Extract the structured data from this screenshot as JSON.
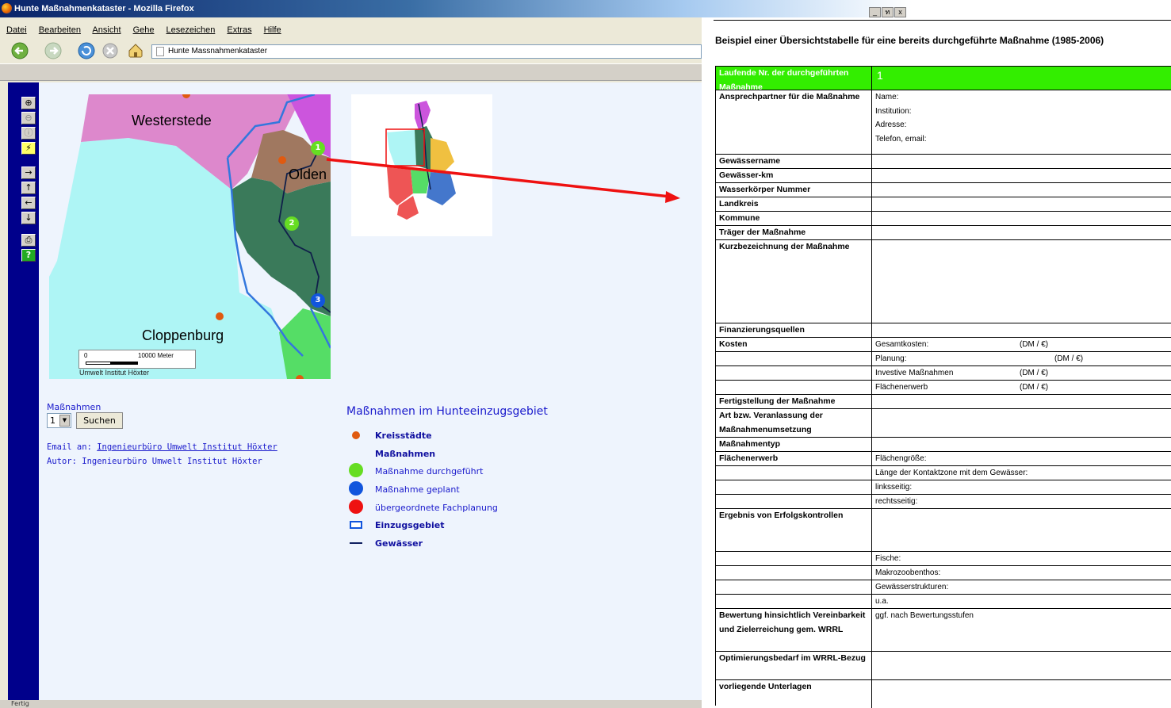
{
  "browser": {
    "title": "Hunte Maßnahmenkataster - Mozilla Firefox",
    "window_buttons": [
      "_",
      "ท",
      "x"
    ],
    "menu": [
      "Datei",
      "Bearbeiten",
      "Ansicht",
      "Gehe",
      "Lesezeichen",
      "Extras",
      "Hilfe"
    ],
    "url": "Hunte Massnahmenkataster",
    "status": "Fertig"
  },
  "toolbar_icons": [
    "zoom-in-icon",
    "zoom-out-icon",
    "info-icon",
    "select-icon",
    "pan-east-icon",
    "pan-north-icon",
    "pan-west-icon",
    "pan-south-icon",
    "print-icon",
    "help-icon"
  ],
  "map": {
    "labels": {
      "westerstede": "Westerstede",
      "olden": "Olden",
      "cloppenburg": "Cloppenburg"
    },
    "markers": [
      "1",
      "2",
      "3"
    ],
    "scale_zero": "0",
    "scale_text": "10000 Meter",
    "credit": "Umwelt Institut Höxter"
  },
  "form": {
    "label": "Maßnahmen",
    "select_value": "1",
    "search_button": "Suchen"
  },
  "info": {
    "email_prefix": "Email an: ",
    "email_link": "Ingenieurbüro Umwelt Institut Höxter",
    "author": "Autor: Ingenieurbüro Umwelt Institut Höxter"
  },
  "legend": {
    "title": "Maßnahmen im Hunteeinzugsgebiet",
    "items": [
      {
        "label": "Kreisstädte",
        "color": "#e05a10"
      },
      {
        "label": "Maßnahmen",
        "color": ""
      },
      {
        "label": "Maßnahme durchgeführt",
        "color": "#66dd22"
      },
      {
        "label": "Maßnahme geplant",
        "color": "#1155dd"
      },
      {
        "label": "übergeordnete Fachplanung",
        "color": "#ee1111"
      },
      {
        "label": "Einzugsgebiet",
        "color": "#1155dd"
      },
      {
        "label": "Gewässer",
        "color": "#102060"
      }
    ]
  },
  "doc": {
    "title": "Beispiel einer Übersichtstabelle für eine bereits durchgeführte Maßnahme (1985-2006)",
    "rows": [
      {
        "left": "Laufende Nr. der durchgeführten Maßnahme",
        "right": "1"
      },
      {
        "left": "Ansprechpartner für die Maßnahme",
        "right_lines": [
          "Name:",
          "Institution:",
          "Adresse:",
          "Telefon, email:"
        ]
      },
      {
        "left": "Gewässername",
        "right": ""
      },
      {
        "left": "Gewässer-km",
        "right": ""
      },
      {
        "left": "Wasserkörper Nummer",
        "right": ""
      },
      {
        "left": "Landkreis",
        "right": ""
      },
      {
        "left": "Kommune",
        "right": ""
      },
      {
        "left": "Träger der Maßnahme",
        "right": ""
      },
      {
        "left": "Kurzbezeichnung der Maßnahme",
        "right": ""
      },
      {
        "left": "Finanzierungsquellen",
        "right": ""
      },
      {
        "left": "Kosten",
        "right": "Gesamtkosten:",
        "unit": "(DM / €)"
      },
      {
        "left": "",
        "right": "Planung:",
        "unit": "(DM / €)"
      },
      {
        "left": "",
        "right": "Investive Maßnahmen",
        "unit": "(DM / €)"
      },
      {
        "left": "",
        "right": "Flächenerwerb",
        "unit": "(DM / €)"
      },
      {
        "left": "Fertigstellung der Maßnahme",
        "right": ""
      },
      {
        "left": "Art bzw. Veranlassung der Maßnahmenumsetzung",
        "right": ""
      },
      {
        "left": "Maßnahmentyp",
        "right": ""
      },
      {
        "left": "Flächenerwerb",
        "right": "Flächengröße:"
      },
      {
        "left": "",
        "right": "Länge der Kontaktzone mit dem Gewässer:"
      },
      {
        "left": "",
        "right": "linksseitig:"
      },
      {
        "left": "",
        "right": "rechtsseitig:"
      },
      {
        "left": "Ergebnis von Erfolgskontrollen",
        "right": ""
      },
      {
        "left": "",
        "right": "Fische:"
      },
      {
        "left": "",
        "right": "Makrozoobenthos:"
      },
      {
        "left": "",
        "right": "Gewässerstrukturen:"
      },
      {
        "left": "",
        "right": "u.a."
      },
      {
        "left": "Bewertung hinsichtlich Vereinbarkeit und Zielerreichung gem. WRRL",
        "right": "ggf. nach Bewertungsstufen"
      },
      {
        "left": "Optimierungsbedarf im WRRL-Bezug",
        "right": ""
      },
      {
        "left": "vorliegende Unterlagen",
        "right": ""
      }
    ]
  }
}
